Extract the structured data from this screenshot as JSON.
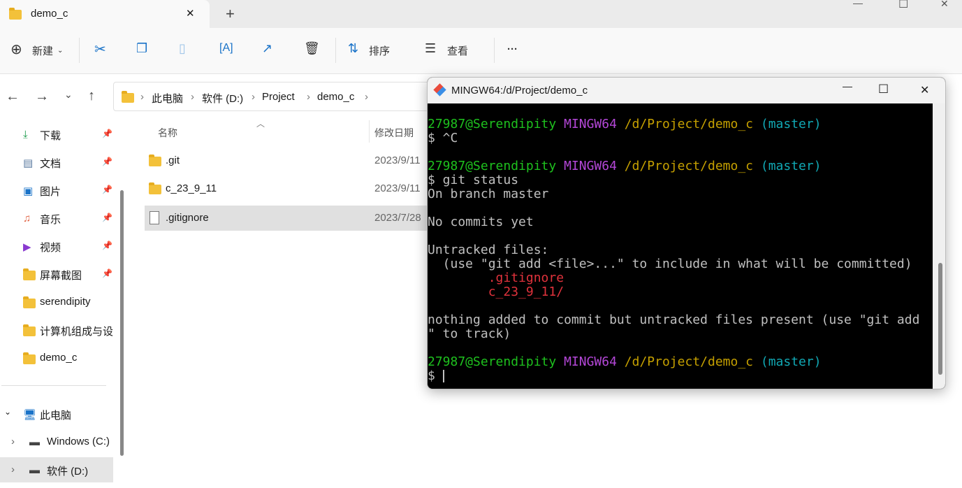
{
  "tab": {
    "title": "demo_c",
    "close": "✕",
    "new": "+"
  },
  "window_controls": {
    "min": "—",
    "max": "☐",
    "close": "✕"
  },
  "toolbar": {
    "new": "新建",
    "sort": "排序",
    "view": "查看",
    "more": "···"
  },
  "address": {
    "crumbs": [
      "此电脑",
      "软件 (D:)",
      "Project",
      "demo_c"
    ]
  },
  "sidebar": {
    "quick": [
      {
        "label": "下载",
        "pinned": true
      },
      {
        "label": "文档",
        "pinned": true
      },
      {
        "label": "图片",
        "pinned": true
      },
      {
        "label": "音乐",
        "pinned": true
      },
      {
        "label": "视频",
        "pinned": true
      },
      {
        "label": "屏幕截图",
        "pinned": true
      },
      {
        "label": "serendipity"
      },
      {
        "label": "计算机组成与设"
      },
      {
        "label": "demo_c"
      }
    ],
    "this_pc": "此电脑",
    "drives": [
      "Windows (C:)",
      "软件 (D:)"
    ]
  },
  "files": {
    "col_name": "名称",
    "col_date": "修改日期",
    "rows": [
      {
        "name": ".git",
        "date": "2023/9/11"
      },
      {
        "name": "c_23_9_11",
        "date": "2023/9/11"
      },
      {
        "name": ".gitignore",
        "date": "2023/7/28"
      }
    ]
  },
  "terminal": {
    "title": "MINGW64:/d/Project/demo_c",
    "prompt": {
      "user": "27987@Serendipity",
      "sys": "MINGW64",
      "path": "/d/Project/demo_c",
      "branch": "(master)"
    },
    "lines": [
      "$ ^C",
      "$ git status",
      "On branch master",
      "No commits yet",
      "Untracked files:",
      "  (use \"git add <file>...\" to include in what will be committed)",
      "        .gitignore",
      "        c_23_9_11/",
      "nothing added to commit but untracked files present (use \"git add",
      "\" to track)",
      "$ "
    ]
  }
}
